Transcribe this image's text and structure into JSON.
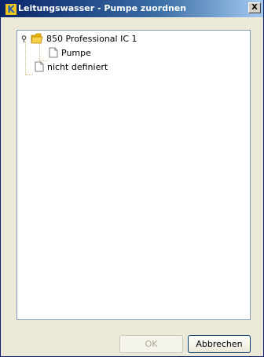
{
  "window": {
    "title": "Leitungswasser - Pumpe zuordnen",
    "close_glyph": "X",
    "app_icon": "k-logo-icon"
  },
  "tree": {
    "nodes": [
      {
        "label": "850 Professional IC 1",
        "icon": "folder-open-icon",
        "expanded": true,
        "level": 0
      },
      {
        "label": "Pumpe",
        "icon": "document-icon",
        "level": 1
      },
      {
        "label": "nicht definiert",
        "icon": "document-icon",
        "level": 0
      }
    ]
  },
  "buttons": {
    "ok_label": "OK",
    "ok_enabled": false,
    "cancel_label": "Abbrechen"
  },
  "colors": {
    "title_start": "#0a246a",
    "title_end": "#a6caf0",
    "dialog_bg": "#ece9d8",
    "tree_border": "#7f9db9",
    "tree_line": "#d8c48a",
    "folder": "#f0c419"
  }
}
